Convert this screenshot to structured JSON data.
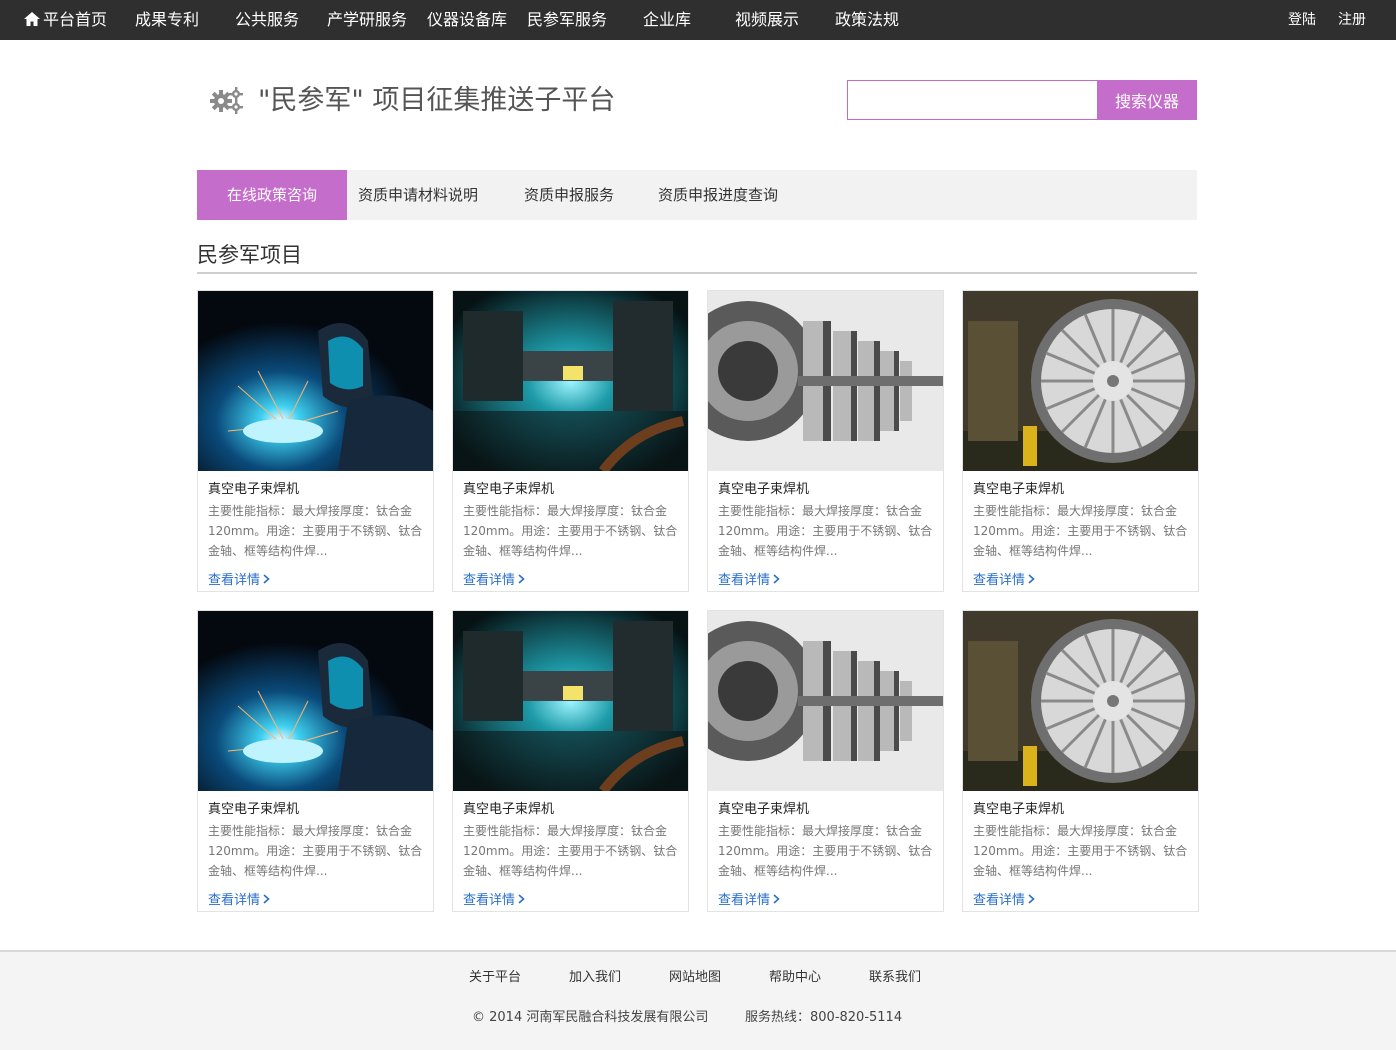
{
  "nav": {
    "items": [
      {
        "label": "平台首页",
        "icon": "home-icon"
      },
      {
        "label": "成果专利"
      },
      {
        "label": "公共服务"
      },
      {
        "label": "产学研服务"
      },
      {
        "label": "仪器设备库"
      },
      {
        "label": "民参军服务"
      },
      {
        "label": "企业库"
      },
      {
        "label": "视频展示"
      },
      {
        "label": "政策法规"
      }
    ],
    "login": "登陆",
    "register": "注册"
  },
  "header": {
    "title": "\"民参军\" 项目征集推送子平台",
    "icon": "gears-icon",
    "search_value": "",
    "search_button": "搜索仪器"
  },
  "tabs": [
    {
      "label": "在线政策咨询",
      "active": true
    },
    {
      "label": "资质申请材料说明"
    },
    {
      "label": "资质申报服务"
    },
    {
      "label": "资质申报进度查询"
    }
  ],
  "section": {
    "title": "民参军项目"
  },
  "cards": [
    {
      "image": "welder",
      "name": "真空电子束焊机",
      "desc": "主要性能指标：最大焊接厚度：钛合金 120mm。用途：主要用于不锈钢、钛合金轴、框等结构件焊...",
      "link": "查看详情"
    },
    {
      "image": "laser",
      "name": "真空电子束焊机",
      "desc": "主要性能指标：最大焊接厚度：钛合金 120mm。用途：主要用于不锈钢、钛合金轴、框等结构件焊...",
      "link": "查看详情"
    },
    {
      "image": "gearbox",
      "name": "真空电子束焊机",
      "desc": "主要性能指标：最大焊接厚度：钛合金 120mm。用途：主要用于不锈钢、钛合金轴、框等结构件焊...",
      "link": "查看详情"
    },
    {
      "image": "turbine",
      "name": "真空电子束焊机",
      "desc": "主要性能指标：最大焊接厚度：钛合金 120mm。用途：主要用于不锈钢、钛合金轴、框等结构件焊...",
      "link": "查看详情"
    },
    {
      "image": "welder",
      "name": "真空电子束焊机",
      "desc": "主要性能指标：最大焊接厚度：钛合金 120mm。用途：主要用于不锈钢、钛合金轴、框等结构件焊...",
      "link": "查看详情"
    },
    {
      "image": "laser",
      "name": "真空电子束焊机",
      "desc": "主要性能指标：最大焊接厚度：钛合金 120mm。用途：主要用于不锈钢、钛合金轴、框等结构件焊...",
      "link": "查看详情"
    },
    {
      "image": "gearbox",
      "name": "真空电子束焊机",
      "desc": "主要性能指标：最大焊接厚度：钛合金 120mm。用途：主要用于不锈钢、钛合金轴、框等结构件焊...",
      "link": "查看详情"
    },
    {
      "image": "turbine",
      "name": "真空电子束焊机",
      "desc": "主要性能指标：最大焊接厚度：钛合金 120mm。用途：主要用于不锈钢、钛合金轴、框等结构件焊...",
      "link": "查看详情"
    }
  ],
  "footer": {
    "links": [
      "关于平台",
      "加入我们",
      "网站地图",
      "帮助中心",
      "联系我们"
    ],
    "copyright": "© 2014 河南军民融合科技发展有限公司",
    "hotline": "服务热线：800-820-5114"
  },
  "colors": {
    "accent": "#c56dcb",
    "nav_bg": "#2f2f2f",
    "link": "#2a6fc9"
  }
}
